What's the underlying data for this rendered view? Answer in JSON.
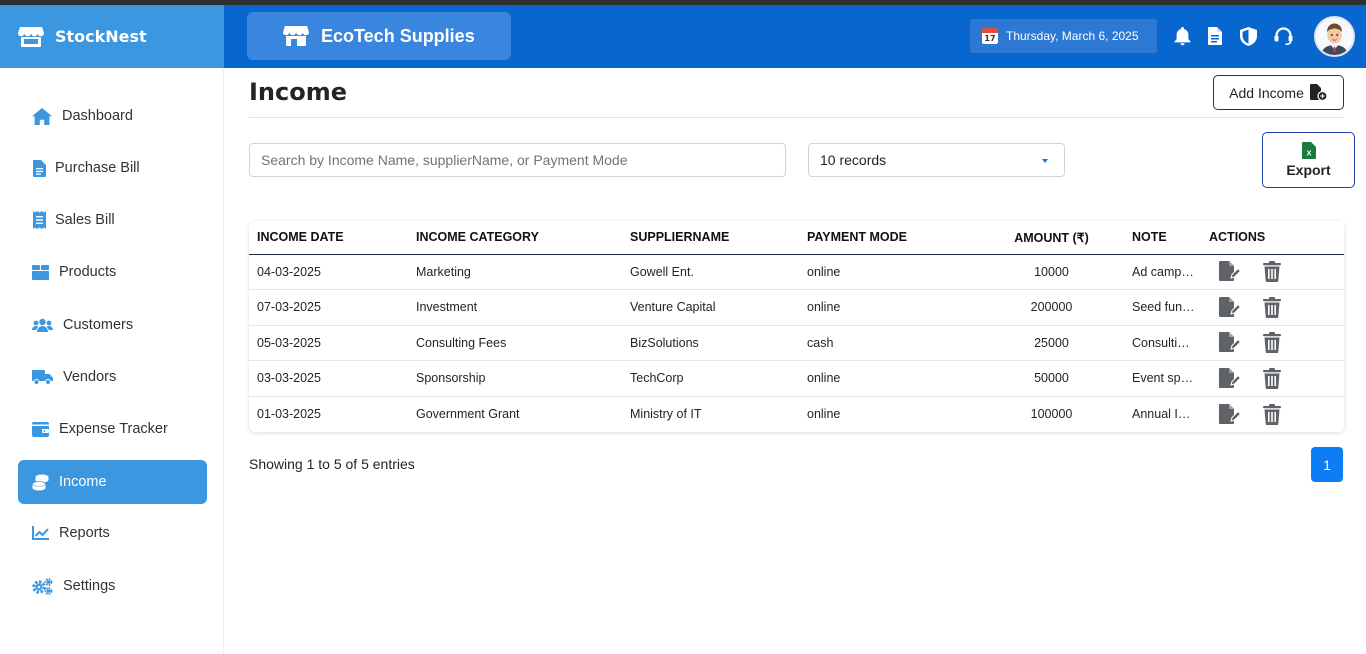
{
  "app": {
    "brand": "StockNest"
  },
  "header": {
    "company": "EcoTech Supplies",
    "date": "Thursday, March 6, 2025",
    "calendar_day": "17",
    "icons": [
      "bell-icon",
      "document-icon",
      "shield-icon",
      "headset-icon"
    ]
  },
  "sidebar": {
    "items": [
      {
        "label": "Dashboard",
        "icon": "home-icon"
      },
      {
        "label": "Purchase Bill",
        "icon": "file-icon"
      },
      {
        "label": "Sales Bill",
        "icon": "receipt-icon"
      },
      {
        "label": "Products",
        "icon": "box-icon"
      },
      {
        "label": "Customers",
        "icon": "users-icon"
      },
      {
        "label": "Vendors",
        "icon": "truck-icon"
      },
      {
        "label": "Expense Tracker",
        "icon": "wallet-icon"
      },
      {
        "label": "Income",
        "icon": "coins-icon",
        "active": true
      },
      {
        "label": "Reports",
        "icon": "chart-line-icon"
      },
      {
        "label": "Settings",
        "icon": "cogs-icon"
      }
    ]
  },
  "main": {
    "title": "Income",
    "add_button": "Add Income",
    "search_placeholder": "Search by Income Name, supplierName, or Payment Mode",
    "records_select": "10 records",
    "export_button": "Export",
    "export_icon_letter": "X",
    "table": {
      "columns": [
        "INCOME DATE",
        "INCOME CATEGORY",
        "SUPPLIERNAME",
        "PAYMENT MODE",
        "AMOUNT (₹)",
        "NOTE",
        "ACTIONS"
      ],
      "rows": [
        {
          "date": "04-03-2025",
          "category": "Marketing",
          "supplier": "Gowell Ent.",
          "mode": "online",
          "amount": "10000",
          "note": "Ad camp…"
        },
        {
          "date": "07-03-2025",
          "category": "Investment",
          "supplier": "Venture Capital",
          "mode": "online",
          "amount": "200000",
          "note": "Seed fun…"
        },
        {
          "date": "05-03-2025",
          "category": "Consulting Fees",
          "supplier": "BizSolutions",
          "mode": "cash",
          "amount": "25000",
          "note": "Consulti…"
        },
        {
          "date": "03-03-2025",
          "category": "Sponsorship",
          "supplier": "TechCorp",
          "mode": "online",
          "amount": "50000",
          "note": "Event sp…"
        },
        {
          "date": "01-03-2025",
          "category": "Government Grant",
          "supplier": "Ministry of IT",
          "mode": "online",
          "amount": "100000",
          "note": "Annual I…"
        }
      ]
    },
    "showing": "Showing 1 to 5 of 5 entries",
    "page": "1"
  },
  "colors": {
    "sidebar_accent": "#3a97e0",
    "header_bg": "#0866cf",
    "pagination": "#0d7df4",
    "export_icon": "#1d7a3c"
  }
}
